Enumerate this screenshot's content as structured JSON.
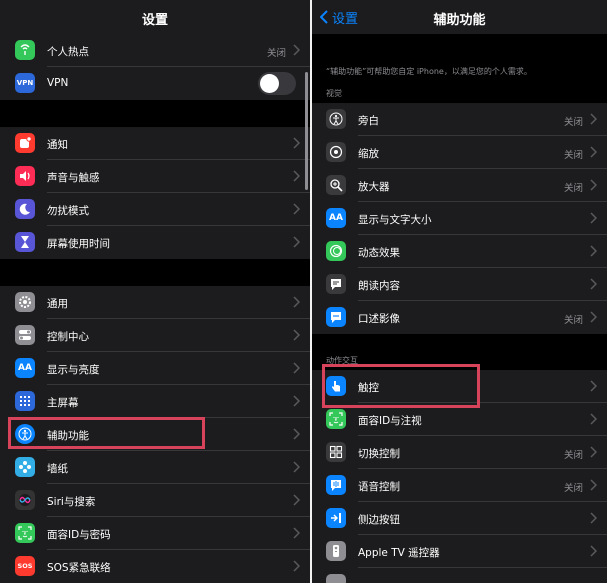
{
  "left": {
    "title": "设置",
    "rows": [
      {
        "label": "个人热点",
        "value": "关闭",
        "icon": "hotspot-icon",
        "color": "#34c759"
      },
      {
        "label": "VPN",
        "icon": "vpn-icon",
        "color": "#2c68d9",
        "icon_text": "VPN",
        "toggle_on": false
      },
      {
        "label": "通知",
        "icon": "notifications-icon",
        "color": "#ff3b30"
      },
      {
        "label": "声音与触感",
        "icon": "sound-icon",
        "color": "#ff2d55"
      },
      {
        "label": "勿扰模式",
        "icon": "moon-icon",
        "color": "#5856d6"
      },
      {
        "label": "屏幕使用时间",
        "icon": "hourglass-icon",
        "color": "#5856d6"
      },
      {
        "label": "通用",
        "icon": "gear-icon",
        "color": "#8e8e93"
      },
      {
        "label": "控制中心",
        "icon": "toggles-icon",
        "color": "#8e8e93"
      },
      {
        "label": "显示与亮度",
        "icon": "text-size-icon",
        "color": "#0a84ff",
        "icon_text": "AA"
      },
      {
        "label": "主屏幕",
        "icon": "home-grid-icon",
        "color": "#2c68d9"
      },
      {
        "label": "辅助功能",
        "icon": "accessibility-icon",
        "color": "#0a84ff"
      },
      {
        "label": "墙纸",
        "icon": "wallpaper-icon",
        "color": "#32ade6"
      },
      {
        "label": "Siri与搜索",
        "icon": "siri-icon",
        "color": "#333333"
      },
      {
        "label": "面容ID与密码",
        "icon": "faceid-icon",
        "color": "#34c759"
      },
      {
        "label": "SOS紧急联络",
        "icon": "sos-icon",
        "color": "#ff3b30",
        "icon_text": "SOS"
      }
    ]
  },
  "right": {
    "back_label": "设置",
    "title": "辅助功能",
    "description": "“辅助功能”可帮助您自定 iPhone，以满足您的个人需求。",
    "vision_header": "视觉",
    "interaction_header": "动作交互",
    "vision_rows": [
      {
        "label": "旁白",
        "value": "关闭",
        "icon": "voiceover-icon",
        "color": "#3a3a3c"
      },
      {
        "label": "缩放",
        "value": "关闭",
        "icon": "zoom-icon",
        "color": "#3a3a3c"
      },
      {
        "label": "放大器",
        "value": "关闭",
        "icon": "magnifier-icon",
        "color": "#3a3a3c"
      },
      {
        "label": "显示与文字大小",
        "icon": "display-text-icon",
        "color": "#0a84ff",
        "icon_text": "AA"
      },
      {
        "label": "动态效果",
        "icon": "motion-icon",
        "color": "#34c759"
      },
      {
        "label": "朗读内容",
        "icon": "spoken-content-icon",
        "color": "#3a3a3c"
      },
      {
        "label": "口述影像",
        "value": "关闭",
        "icon": "audio-description-icon",
        "color": "#0a84ff"
      }
    ],
    "interaction_rows": [
      {
        "label": "触控",
        "icon": "touch-icon",
        "color": "#0a84ff"
      },
      {
        "label": "面容ID与注视",
        "icon": "faceid-attention-icon",
        "color": "#34c759"
      },
      {
        "label": "切换控制",
        "value": "关闭",
        "icon": "switch-control-icon",
        "color": "#3a3a3c"
      },
      {
        "label": "语音控制",
        "value": "关闭",
        "icon": "voice-control-icon",
        "color": "#0a84ff"
      },
      {
        "label": "侧边按钮",
        "icon": "side-button-icon",
        "color": "#0a84ff"
      },
      {
        "label": "Apple TV 遥控器",
        "icon": "remote-icon",
        "color": "#8e8e93"
      }
    ]
  },
  "highlight_color": "#d6435b"
}
